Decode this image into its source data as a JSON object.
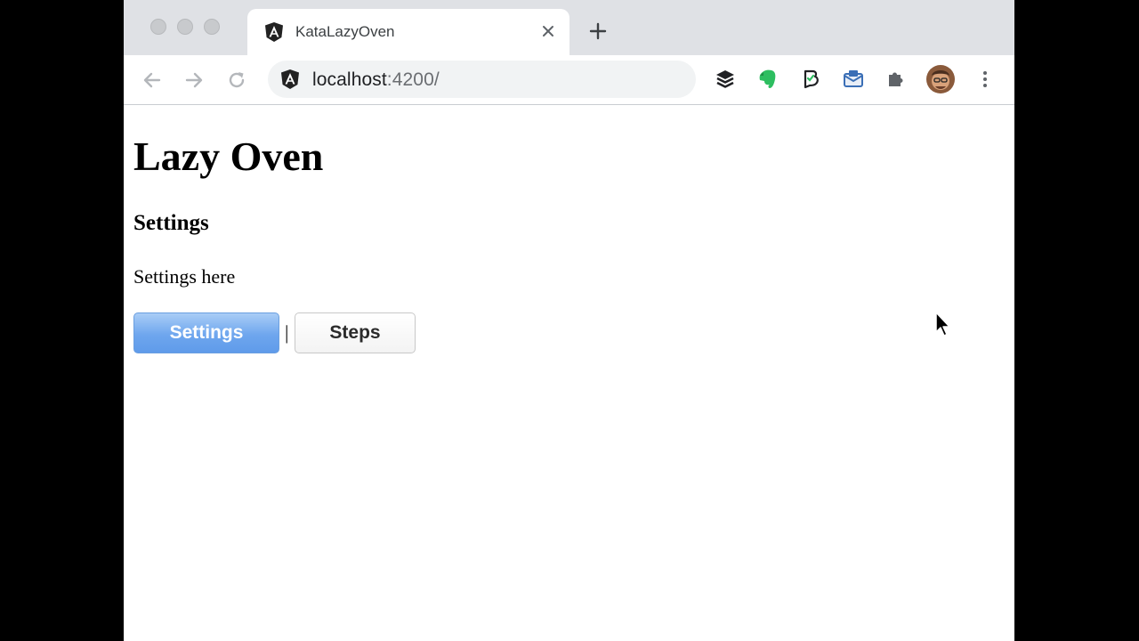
{
  "browser": {
    "tab": {
      "title": "KataLazyOven"
    },
    "address_bar": {
      "host": "localhost",
      "path": ":4200/"
    }
  },
  "page": {
    "title": "Lazy Oven",
    "section_heading": "Settings",
    "body_text": "Settings here",
    "nav": {
      "settings_label": "Settings",
      "separator": "|",
      "steps_label": "Steps",
      "active": "Settings"
    }
  },
  "icons": {
    "tab_favicon": "angular-icon",
    "omnibox_site": "angular-icon",
    "back": "arrow-left-icon",
    "forward": "arrow-right-icon",
    "reload": "reload-icon",
    "new_tab": "plus-icon",
    "close_tab": "close-icon",
    "extensions": [
      "layers-icon",
      "evernote-icon",
      "bookmark-b-icon",
      "mail-icon",
      "puzzle-icon",
      "avatar",
      "more-vert-icon"
    ]
  },
  "colors": {
    "active_button": "#6ea6ee",
    "chrome_frame": "#dfe1e5",
    "evernote": "#2dbe60"
  }
}
